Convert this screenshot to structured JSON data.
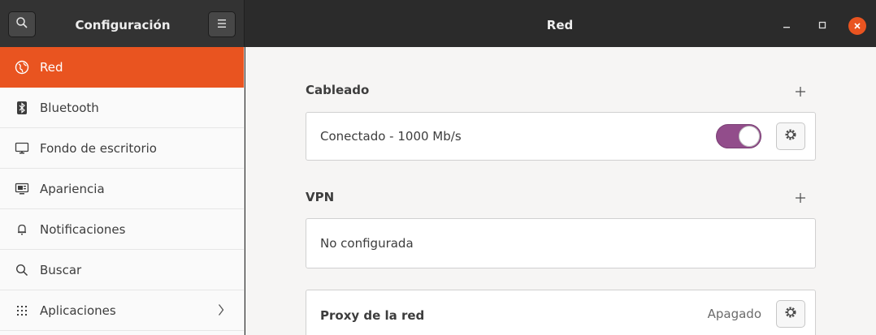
{
  "header": {
    "left_title": "Configuración",
    "right_title": "Red",
    "search_icon": "search-icon",
    "menu_icon": "hamburger-menu-icon",
    "minimize_icon": "minimize-icon",
    "maximize_icon": "maximize-icon",
    "close_icon": "close-icon"
  },
  "sidebar": {
    "items": [
      {
        "label": "Red",
        "icon": "network-globe-icon",
        "active": true
      },
      {
        "label": "Bluetooth",
        "icon": "bluetooth-icon"
      },
      {
        "label": "Fondo de escritorio",
        "icon": "background-icon"
      },
      {
        "label": "Apariencia",
        "icon": "appearance-icon"
      },
      {
        "label": "Notificaciones",
        "icon": "bell-icon"
      },
      {
        "label": "Buscar",
        "icon": "search-icon"
      },
      {
        "label": "Aplicaciones",
        "icon": "apps-grid-icon",
        "has_chevron": true
      }
    ]
  },
  "main": {
    "wired": {
      "title": "Cableado",
      "connection_label": "Conectado - 1000 Mb/s",
      "switch_on": true
    },
    "vpn": {
      "title": "VPN",
      "status": "No configurada"
    },
    "proxy": {
      "label": "Proxy de la red",
      "status": "Apagado"
    }
  },
  "colors": {
    "accent": "#e95420",
    "switch_on": "#924d8b",
    "header_bg": "#2b2b2b"
  }
}
